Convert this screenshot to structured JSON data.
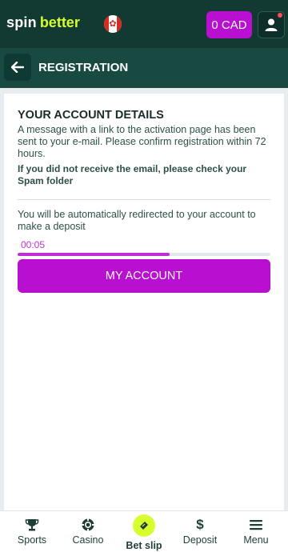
{
  "header": {
    "logo_spin": "spin",
    "logo_better": "better",
    "country_flag": "canada-flag-icon",
    "balance": "0 CAD",
    "user_icon": "user-icon",
    "notification": "red-dot"
  },
  "subheader": {
    "back_icon": "arrow-left-icon",
    "title": "REGISTRATION"
  },
  "card": {
    "title": "YOUR ACCOUNT DETAILS",
    "message": "A message with a link to the activation page has been sent to your e-mail. Please confirm registration within 72 hours.",
    "warning": "If you did not receive the email, please check your Spam folder",
    "redirect_text": "You will be automatically redirected to your account to make a deposit",
    "timer": "00:05",
    "progress_fraction": 0.6,
    "button_label": "MY ACCOUNT"
  },
  "bottom_nav": {
    "items": [
      {
        "label": "Sports",
        "icon": "trophy-icon"
      },
      {
        "label": "Casino",
        "icon": "casino-chip-icon"
      },
      {
        "label": "Bet slip",
        "icon": "ticket-icon"
      },
      {
        "label": "Deposit",
        "icon": "dollar-icon"
      },
      {
        "label": "Menu",
        "icon": "hamburger-icon"
      }
    ]
  },
  "colors": {
    "header_bg": "#123a33",
    "subheader_bg": "#184a42",
    "accent_purple": "#b80fd0",
    "logo_lime": "#d7ff2f"
  }
}
